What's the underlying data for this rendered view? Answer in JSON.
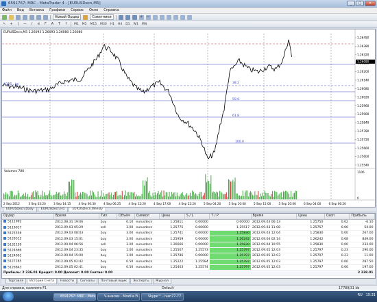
{
  "window": {
    "title": "6591767: MRC - MetaTrader 4 - [EURUSDecn,M5]",
    "minimize": "_",
    "maximize": "□",
    "close": "✕"
  },
  "menu": [
    "Файл",
    "Вид",
    "Вставка",
    "Графики",
    "Сервис",
    "Окно",
    "Справка"
  ],
  "toolbar": {
    "new_order": "Новый Ордер",
    "advisors": "Советники",
    "timeframes": [
      "M1",
      "M5",
      "M15",
      "M30",
      "H1",
      "H4",
      "D1",
      "W1",
      "MN"
    ]
  },
  "chart": {
    "header": "EURUSDecn,M5  1.26093 1.26093 1.26080 1.26080",
    "current_price": "1.26080",
    "price_ticks": [
      "1.26450",
      "1.26380",
      "1.26320",
      "1.26260",
      "1.26200",
      "1.26140",
      "1.26080",
      "1.26020",
      "1.25960",
      "1.25900",
      "1.25840",
      "1.25780",
      "1.25720",
      "1.25660",
      "1.25600",
      "1.25540"
    ],
    "fib_labels": [
      "38.2",
      "50.0",
      "61.8",
      "100.0"
    ],
    "left_label": "#125...l@",
    "volume_label": "Volumes 780",
    "volume_ticks": [
      "1106",
      "0"
    ],
    "time_labels": [
      "2 Sep 2012",
      "3 Sep 03:20",
      "3 Sep 14:15",
      "4 Sep 00:30",
      "4 Sep 06:25",
      "4 Sep 12:20",
      "4 Sep 17:00",
      "4 Sep 22:20",
      "5 Sep 04:20",
      "5 Sep 10:00",
      "5 Sep 15:00",
      "5 Sep 20:00",
      "6 Sep 04:00",
      "6 Sep 06:20"
    ],
    "tabs": [
      "EURUSDecn,Daily",
      "EURUSDecn,H1",
      "EURUSDecn,Weekly"
    ],
    "active_tab": 2
  },
  "terminal": {
    "columns": [
      "Ордер",
      "Время",
      "Тип",
      "Объём",
      "Символ",
      "Цена",
      "S / L",
      "T / P",
      "Время",
      "Цена",
      "Своп",
      "Прибыль"
    ],
    "rows": [
      [
        "5111992",
        "2012.08.31 19:06",
        "buy",
        "0.10",
        "eurusdecn",
        "1.25811",
        "0.00000",
        "0.00000",
        "2012.09.03 06:13",
        "1.25750",
        "0.02",
        "-6.10"
      ],
      [
        "5119017",
        "2012.09.03 05:29",
        "sell",
        "3.00",
        "eurusdecn",
        "1.25775",
        "0.00000",
        "1.25517",
        "2012.09.03 11:08",
        "1.25757",
        "0.00",
        "54.00"
      ],
      [
        "5125556",
        "2012.09.03 08:03",
        "buy",
        "3.00",
        "eurusdecn",
        "1.25741",
        "0.00000",
        "1.25830",
        "2012.09.03 12:04",
        "1.25830",
        "0.00",
        "267.00"
      ],
      [
        "5128312",
        "2012.09.03 15:01",
        "buy",
        "3.00",
        "eurusdecn",
        "1.25959",
        "0.00000",
        "1.26242",
        "2012.09.04 02:14",
        "1.26242",
        "0.68",
        "849.00"
      ],
      [
        "5132159",
        "2012.09.04 06:56",
        "sell",
        "3.00",
        "eurusdecn",
        "1.26666",
        "0.00000",
        "1.25830",
        "2012.09.04 10:55",
        "1.25830",
        "0.00",
        "233.00"
      ],
      [
        "5124666",
        "2012.09.04 23:35",
        "buy",
        "1.00",
        "eurusdecn",
        "1.25507",
        "1.25573",
        "1.25797",
        "2012.09.05 12:03",
        "1.25797",
        "0.23",
        "290.00"
      ],
      [
        "5124001",
        "2012.09.04 15:00",
        "buy",
        "1.00",
        "eurusdecn",
        "1.25786",
        "0.00000",
        "1.25797",
        "2012.09.05 12:03",
        "1.25797",
        "0.23",
        "11.00"
      ],
      [
        "5127285",
        "2012.09.05 02:42",
        "buy",
        "0.50",
        "eurusdecn",
        "1.25222",
        "1.25584",
        "1.25797",
        "2012.09.05 12:03",
        "1.25797",
        "0.00",
        "287.50"
      ],
      [
        "5126843",
        "2012.09.05 02:41",
        "buy",
        "0.50",
        "eurusdecn",
        "1.25403",
        "1.25574",
        "1.25797",
        "2012.09.05 12:03",
        "1.25797",
        "0.00",
        "197.00"
      ]
    ],
    "tp_highlight_rows": [
      2,
      3,
      4,
      5,
      6,
      7,
      8
    ],
    "summary_label": "Прибыль: 2 236.01  Кредит: 0.00  Депозит: 0.00  Снятие: 0.00",
    "summary_value": "2 238.01",
    "tabs": [
      "Торговля",
      "История Счета",
      "Новости",
      "Сигналы",
      "Почтовый ящик",
      "Эксперты",
      "Журнал"
    ],
    "active_tab": 1
  },
  "statusbar": {
    "help": "Для справки, нажмите F1",
    "profile": "Default",
    "traffic": "17789/31 kb"
  },
  "taskbar": {
    "tasks": [
      "6591767: MRC - Meta...",
      "V-анализ - Mozilla Fi...",
      "Skype™ - ivan77-77"
    ],
    "language": "RU",
    "clock": "15:31"
  },
  "colors": {
    "candle": "#000000",
    "fib_line": "#3b45c2",
    "volume": "#2e9e2e",
    "volume_spike": "#c41d1d",
    "tp_highlight": "#6fdc6f"
  }
}
